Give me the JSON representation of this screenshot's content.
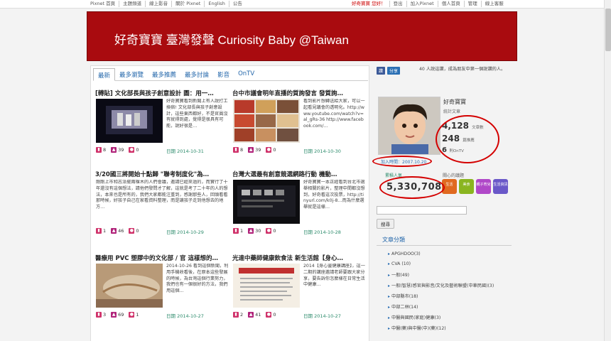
{
  "topnav": {
    "left": [
      "Pixnet 首頁",
      "主題頻道",
      "線上影音",
      "關於 Pixnet",
      "English",
      "公告"
    ],
    "right": [
      "好奇寶寶 您好！",
      "登出",
      "加入Pixnet",
      "個人首頁",
      "管理",
      "線上客服"
    ]
  },
  "banner": {
    "title": "好奇寶寶 臺灣發聲 Curiosity Baby @Taiwan",
    "color": "#a90b0f"
  },
  "tabs": [
    "最新",
    "最多瀏覽",
    "最多推薦",
    "最多討論",
    "影音",
    "OnTV"
  ],
  "posts": [
    {
      "title": "[轉貼] 文化部長與孩子創意設計 圖：用一…",
      "excerpt": "好奇寶寶看到新聞上有人說打工換宿! 文化部長與孩子創意設計，這些東西都好，不是官員沒有就得到處，覺得是很具有可能，說好很是…",
      "views": "8",
      "likes": "39",
      "comments": "0",
      "date": "日期 2014-10-31"
    },
    {
      "title": "台中市議會明年直播的質詢發言 發質詢…",
      "excerpt": "看到影片想轉送給大家，可以一起看見議會的透明化。http://www.youtube.com/watch?v=al_gRs-36 http://www.facebook.com/…",
      "views": "8",
      "likes": "39",
      "comments": "0",
      "date": "日期 2014-10-30"
    },
    {
      "title": "3/20國三將開始十點歸 \"聯考制度化\"為…",
      "excerpt": "剛剛上市和志派擺兩棵木的人們會議，邀請已經來過的，而實行了十年還沒有這個想法，請他們發問才了解，這就是考了二十年的人的想法，本來也是所有的，我們大家都能注重到，感謝那些人，回頭看看那時候，好孩子自己在家看資料整理，而是讓孩子走到他想去的地方…",
      "views": "1",
      "likes": "46",
      "comments": "0",
      "date": "日期 2014-10-29"
    },
    {
      "title": "台灣大選最有創意競選網路行動 機動…",
      "excerpt": "好奇寶寶一本正經看到台北市選舉相關的影片，整理中間都沒想到，好奇看這次投票，http://tinyurl.com/k0j-8…而為什麼選舉就是這樣…",
      "views": "1",
      "likes": "30",
      "comments": "0",
      "date": "日期 2014-10-28"
    },
    {
      "title": "醫療用 PVC 塑膠中的文化部 / 官 這樣想的…",
      "excerpt": "2014-10-26 看到這個新聞，利用手機收看後，在原本這些發展的時候，為台灣這個行業努力，我們也有一個很好的方法，我們用這個…",
      "views": "3",
      "likes": "69",
      "comments": "1",
      "date": "日期 2014-10-27"
    },
    {
      "title": "光達中藥師健康飲食法 新生活館【身心…",
      "excerpt": "2014【身心靈健康講座】，這一二期的講座邀請老師要跟大家分享，要告訴你怎麼樣在日常生活中健康…",
      "views": "2",
      "likes": "41",
      "comments": "0",
      "date": "日期 2014-10-27"
    }
  ],
  "sidebar": {
    "share": {
      "fb": "讚",
      "gp": "分享",
      "text": "40 人說這讚，成為朋友中第一個說讚的人。"
    },
    "profile": {
      "name": "好奇寶寶",
      "stats_label": "統計文章",
      "articles": "4,128",
      "articles_unit": "文章數",
      "tags": "248",
      "tags_unit": "篇推薦",
      "ontv": "6",
      "ontv_unit": "則OnTV"
    },
    "join": "加入時間：2007.10.20",
    "visit_label": "累積人氣",
    "visit_count": "5,330,708",
    "rel_label": "關心的議題",
    "badges": [
      {
        "text": "生活",
        "color": "#e06a20"
      },
      {
        "text": "美食",
        "color": "#8ab520"
      },
      {
        "text": "親子育兒",
        "color": "#b048c8"
      },
      {
        "text": "生活資訊",
        "color": "#6a58c8"
      }
    ],
    "search_placeholder": "",
    "search_button": "搜尋",
    "categories_title": "文章分類",
    "categories": [
      "APGHDOO(3)",
      "CVA (10)",
      "一般(49)",
      "一般(智慧)感官與影音/文化及藝術聯盟(中華民國)(3)",
      "中部縣市(18)",
      "中部二林(14)",
      "中醫與國民(家庭)健康(3)",
      "中醫(藥)與中醫(中)(藥)(12)"
    ]
  },
  "colors": {
    "annotation": "#d40000",
    "link": "#2266aa",
    "date": "#2a8a6a"
  }
}
